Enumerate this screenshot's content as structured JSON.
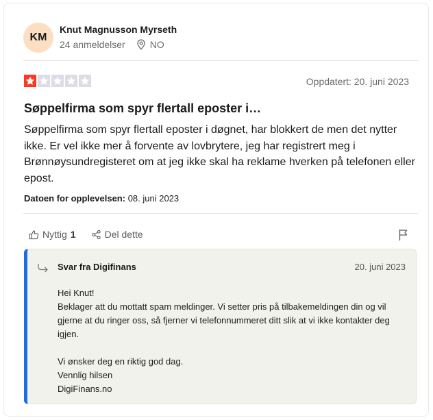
{
  "reviewer": {
    "initials": "KM",
    "name": "Knut Magnusson Myrseth",
    "review_count": "24 anmeldelser",
    "country": "NO"
  },
  "review": {
    "rating": 1,
    "rating_max": 5,
    "star_color": "#ff3722",
    "star_empty_color": "#dcdce6",
    "updated": "Oppdatert: 20. juni 2023",
    "title": "Søppelfirma som spyr flertall eposter i…",
    "body": "Søppelfirma som spyr flertall eposter i døgnet, har blokkert de men det nytter ikke. Er vel ikke mer å forvente av lovbrytere, jeg har registrert meg i Brønnøysundregisteret om at jeg ikke skal ha reklame hverken på telefonen eller epost.",
    "experience_label": "Datoen for opplevelsen:",
    "experience_date": "08. juni 2023"
  },
  "actions": {
    "useful_label": "Nyttig",
    "useful_count": "1",
    "share_label": "Del dette"
  },
  "reply": {
    "from": "Svar fra Digifinans",
    "date": "20. juni 2023",
    "text": "Hei Knut!\nBeklager att du mottatt spam meldinger. Vi setter pris på tilbakemeldingen din og vil gjerne at du ringer oss, så fjerner vi telefonnummeret ditt slik at vi ikke kontakter deg igjen.\n\nVi ønsker deg en riktig god dag.\nVennlig hilsen\nDigiFinans.no",
    "accent_color": "#1b6fe0"
  }
}
